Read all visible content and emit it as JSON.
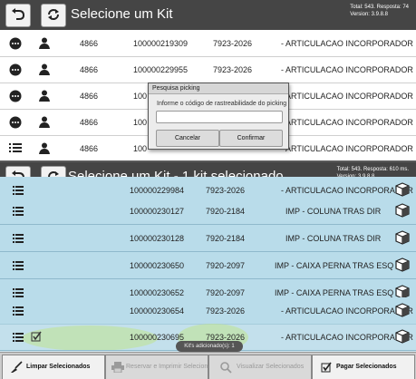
{
  "top_screen": {
    "title": "Selecione um Kit",
    "info_line1": "Total: 543. Resposta: 74",
    "info_line2": "Version: 3.9.8.8",
    "rows": [
      {
        "id": "4866",
        "code": "100000219309",
        "ref": "7923-2026",
        "desc": "- ARTICULACAO INCORPORADOR I",
        "icon": "more-icon"
      },
      {
        "id": "4866",
        "code": "100000229955",
        "ref": "7923-2026",
        "desc": "- ARTICULACAO INCORPORADOR I",
        "icon": "more-icon"
      },
      {
        "id": "4866",
        "code": "100",
        "ref": "",
        "desc": "- ARTICULACAO INCORPORADOR I",
        "icon": "more-icon"
      },
      {
        "id": "4866",
        "code": "100",
        "ref": "",
        "desc": "- ARTICULACAO INCORPORADOR I",
        "icon": "more-icon"
      },
      {
        "id": "4866",
        "code": "100",
        "ref": "",
        "desc": "- ARTICULACAO INCORPORADOR I",
        "icon": "list-icon"
      }
    ],
    "dialog": {
      "title": "Pesquisa picking",
      "message": "Informe o código de rastreabilidade do picking",
      "input_value": "",
      "cancel": "Cancelar",
      "confirm": "Confirmar"
    }
  },
  "bottom_screen": {
    "title": "Selecione um Kit - 1 kit selecionado",
    "info_line1": "Total: 543. Resposta: 610 ms.",
    "info_line2": "Version: 3.9.8.8",
    "partial_row": {
      "code": "100000229984",
      "ref": "7923-2026",
      "desc": "- ARTICULACAO INCORPORADOR I"
    },
    "rows": [
      {
        "code": "100000230127",
        "ref": "7920-2184",
        "desc": "IMP - COLUNA TRAS DIR",
        "checked": false
      },
      {
        "code": "100000230128",
        "ref": "7920-2184",
        "desc": "IMP - COLUNA TRAS DIR",
        "checked": false
      },
      {
        "code": "100000230650",
        "ref": "7920-2097",
        "desc": "IMP - CAIXA PERNA TRAS ESQ",
        "checked": false
      },
      {
        "code": "100000230652",
        "ref": "7920-2097",
        "desc": "IMP - CAIXA PERNA TRAS ESQ",
        "checked": false
      },
      {
        "code": "100000230654",
        "ref": "7923-2026",
        "desc": "- ARTICULACAO INCORPORADOR I",
        "checked": false
      },
      {
        "code": "100000230695",
        "ref": "7923-2026",
        "desc": "- ARTICULACAO INCORPORADOR I",
        "checked": true
      }
    ],
    "toast": "Kit's adicionado(s): 1",
    "buttons": {
      "clear": "Limpar Selecionados",
      "reserve": "Reservar e Imprimir Seleciona",
      "view": "Visualizar Selecionados",
      "pay": "Pagar Selecionados"
    }
  },
  "colors": {
    "header": "#454545",
    "row_blue": "#b9dcea",
    "highlight": "#c8eb1e"
  }
}
